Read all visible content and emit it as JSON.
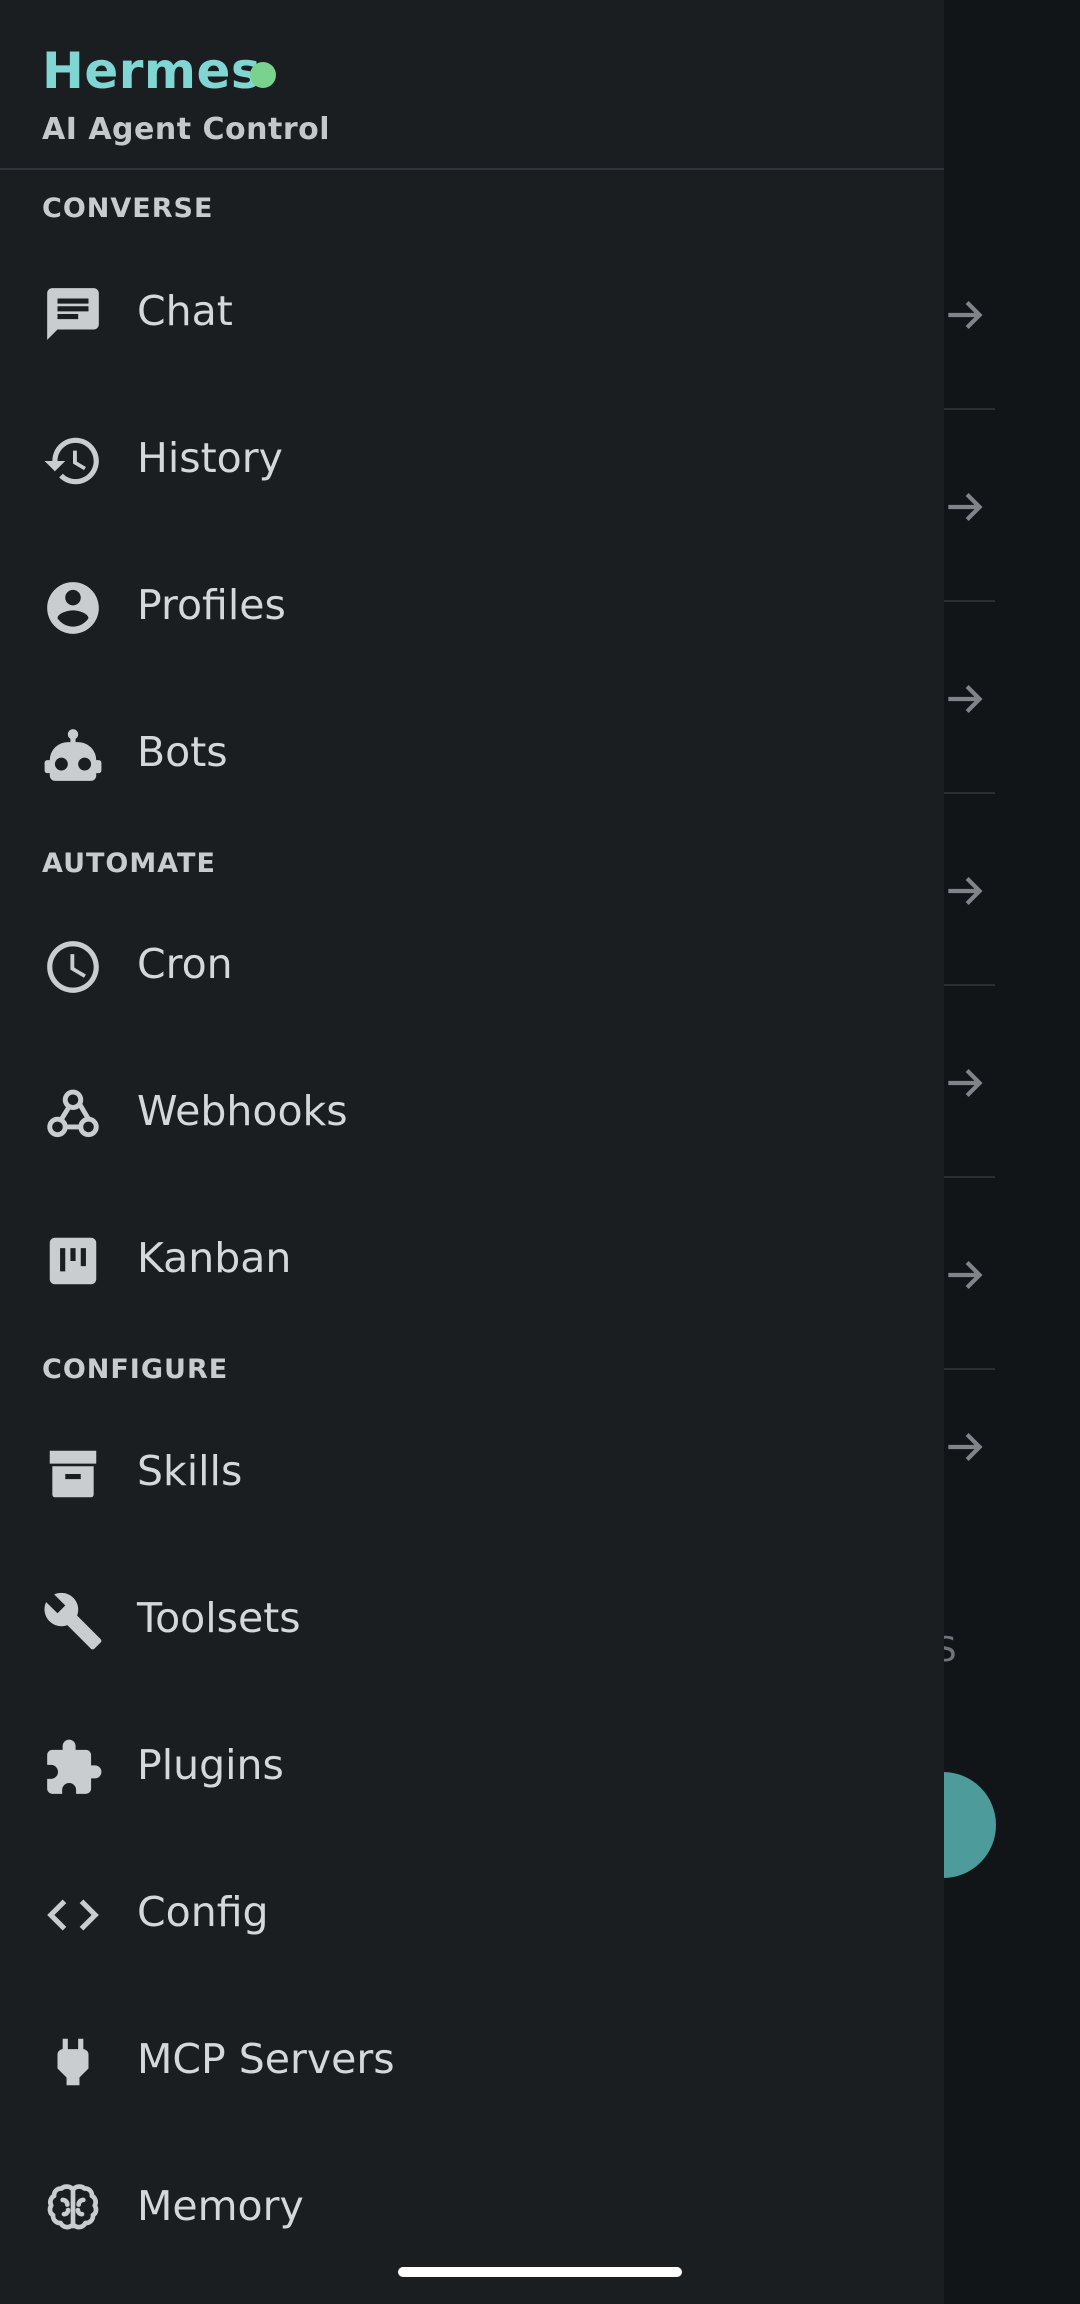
{
  "header": {
    "title": "Hermes",
    "subtitle": "AI Agent Control",
    "status_color": "#79d28d",
    "accent_color": "#7fd6d2"
  },
  "sections": [
    {
      "label": "CONVERSE",
      "items": [
        {
          "label": "Chat",
          "icon": "chat-icon"
        },
        {
          "label": "History",
          "icon": "history-icon"
        },
        {
          "label": "Profiles",
          "icon": "account-circle-icon"
        },
        {
          "label": "Bots",
          "icon": "robot-icon"
        }
      ]
    },
    {
      "label": "AUTOMATE",
      "items": [
        {
          "label": "Cron",
          "icon": "clock-icon"
        },
        {
          "label": "Webhooks",
          "icon": "webhook-icon"
        },
        {
          "label": "Kanban",
          "icon": "kanban-board-icon"
        }
      ]
    },
    {
      "label": "CONFIGURE",
      "items": [
        {
          "label": "Skills",
          "icon": "archive-box-icon"
        },
        {
          "label": "Toolsets",
          "icon": "wrench-icon"
        },
        {
          "label": "Plugins",
          "icon": "puzzle-piece-icon"
        },
        {
          "label": "Config",
          "icon": "code-brackets-icon"
        },
        {
          "label": "MCP Servers",
          "icon": "power-plug-icon"
        },
        {
          "label": "Memory",
          "icon": "brain-icon"
        }
      ]
    }
  ],
  "background": {
    "partial_text": "S",
    "fab_color": "#4d9b9a"
  }
}
